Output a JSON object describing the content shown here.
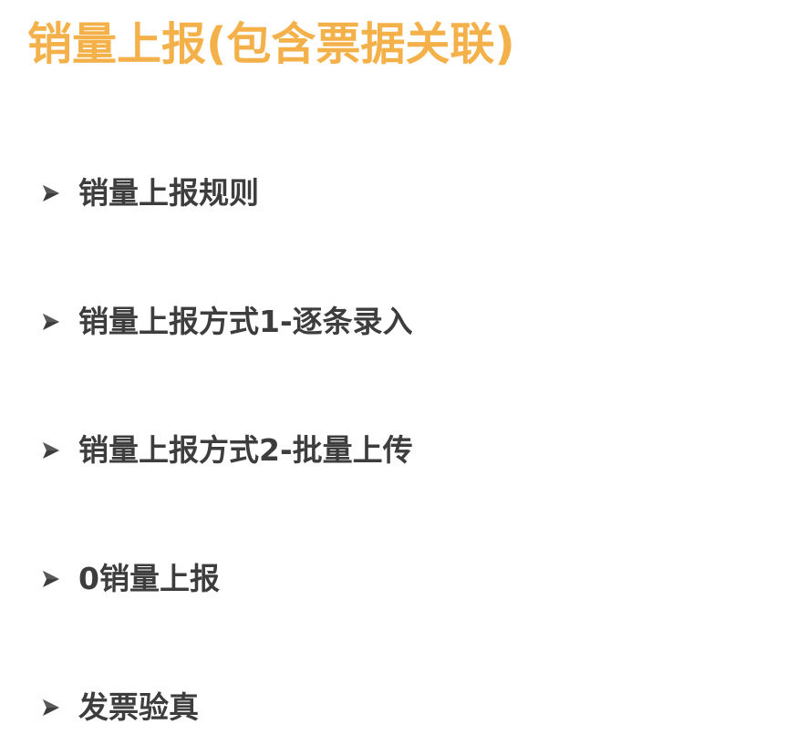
{
  "slide": {
    "title": "销量上报(包含票据关联)",
    "accent_color": "#f4b14a",
    "text_color": "#3d3d3d",
    "bullet_icon": "arrowhead-bullet-icon",
    "items": [
      {
        "label": "销量上报规则"
      },
      {
        "label": "销量上报方式1-逐条录入"
      },
      {
        "label": "销量上报方式2-批量上传"
      },
      {
        "label": "0销量上报"
      },
      {
        "label": "发票验真"
      }
    ]
  }
}
